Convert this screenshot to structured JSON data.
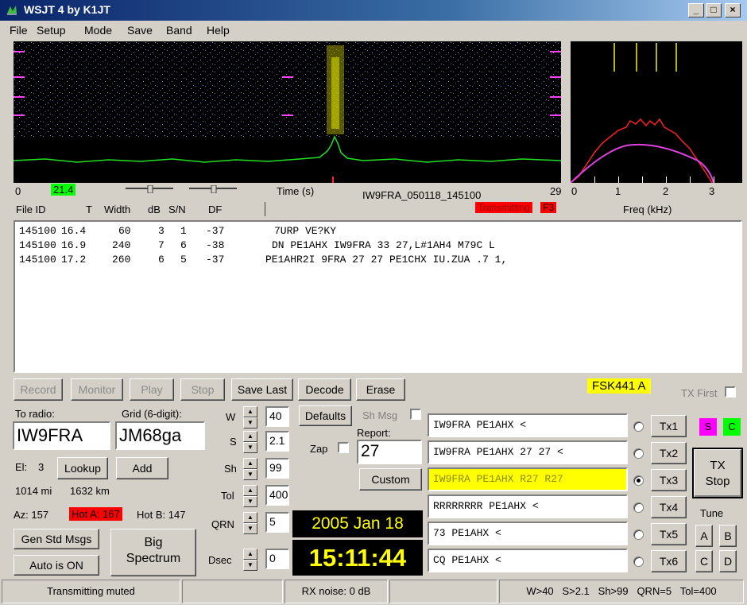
{
  "window": {
    "title": "WSJT 4    by K1JT",
    "min": "_",
    "max": "□",
    "close": "×"
  },
  "menu": [
    "File",
    "Setup",
    "Mode",
    "Save",
    "Band",
    "Help"
  ],
  "waterfall": {
    "x_start": "0",
    "x_marker": "21.4",
    "time_label": "Time (s)",
    "file_label": "IW9FRA_050118_145100",
    "x_end": "29",
    "transmitting": "Transmitting",
    "f_key": "F3"
  },
  "spectrum": {
    "ticks": [
      "0",
      "1",
      "2",
      "3"
    ],
    "freq_label": "Freq (kHz)"
  },
  "decode_header": {
    "file_id": "File ID",
    "t": "T",
    "width": "Width",
    "db": "dB",
    "sn": "S/N",
    "df": "DF"
  },
  "decodes": [
    {
      "file_id": "145100",
      "t": "16.4",
      "width": "60",
      "db": "3",
      "sn": "1",
      "df": "-37",
      "text": "7URP VE?KY"
    },
    {
      "file_id": "145100",
      "t": "16.9",
      "width": "240",
      "db": "7",
      "sn": "6",
      "df": "-38",
      "text": "DN PE1AHX IW9FRA 33 27,L#1AH4 M79C L"
    },
    {
      "file_id": "145100",
      "t": "17.2",
      "width": "260",
      "db": "6",
      "sn": "5",
      "df": "-37",
      "text": "PE1AHR2I 9FRA 27 27 PE1CHX IU.ZUA .7 1,"
    }
  ],
  "buttons": {
    "record": "Record",
    "monitor": "Monitor",
    "play": "Play",
    "stop": "Stop",
    "save_last": "Save Last",
    "decode": "Decode",
    "erase": "Erase",
    "lookup": "Lookup",
    "add": "Add",
    "gen_std": "Gen Std Msgs",
    "auto": "Auto is ON",
    "big_spectrum_1": "Big",
    "big_spectrum_2": "Spectrum",
    "defaults": "Defaults",
    "custom": "Custom",
    "tx_stop_1": "TX",
    "tx_stop_2": "Stop",
    "tune_a": "A",
    "tune_b": "B",
    "tune_c": "C",
    "tune_d": "D"
  },
  "mode_badge": "FSK441 A",
  "tx_first_label": "TX First",
  "station": {
    "to_radio_label": "To radio:",
    "to_radio": "IW9FRA",
    "grid_label": "Grid (6-digit):",
    "grid": "JM68ga",
    "el_label": "El:",
    "el": "3",
    "dist_mi": "1014 mi",
    "dist_km": "1632 km",
    "az": "Az: 157",
    "hot_a": "Hot A: 167",
    "hot_b": "Hot B: 147"
  },
  "params": [
    {
      "label": "W",
      "value": "40"
    },
    {
      "label": "S",
      "value": "2.1"
    },
    {
      "label": "Sh",
      "value": "99"
    },
    {
      "label": "Tol",
      "value": "400"
    },
    {
      "label": "QRN",
      "value": "5"
    },
    {
      "label": "Dsec",
      "value": "0"
    }
  ],
  "sh_msg_label": "Sh Msg",
  "zap_label": "Zap",
  "report_label": "Report:",
  "report_value": "27",
  "date": "2005 Jan 18",
  "time": "15:11:44",
  "tx_messages": [
    {
      "text": "IW9FRA PE1AHX <",
      "btn": "Tx1",
      "selected": false
    },
    {
      "text": "IW9FRA PE1AHX 27 27 <",
      "btn": "Tx2",
      "selected": false
    },
    {
      "text": "IW9FRA PE1AHX R27 R27",
      "btn": "Tx3",
      "selected": true
    },
    {
      "text": "RRRRRRRR PE1AHX <",
      "btn": "Tx4",
      "selected": false
    },
    {
      "text": "73 PE1AHX <",
      "btn": "Tx5",
      "selected": false
    },
    {
      "text": "CQ PE1AHX <",
      "btn": "Tx6",
      "selected": false
    }
  ],
  "indicators": {
    "s": "S",
    "c": "C",
    "s_color": "#ff00ff",
    "c_color": "#00ff00"
  },
  "tune_label": "Tune",
  "status": {
    "tx_muted": "Transmitting muted",
    "rx_noise": "RX noise: 0 dB",
    "summary": "W>40   S>2.1   Sh>99   QRN=5   Tol=400"
  },
  "colors": {
    "transmit_red": "#ff0000",
    "mode_yellow": "#ffff00",
    "marker_green": "#00ff00",
    "clock_text": "#ffff00"
  }
}
